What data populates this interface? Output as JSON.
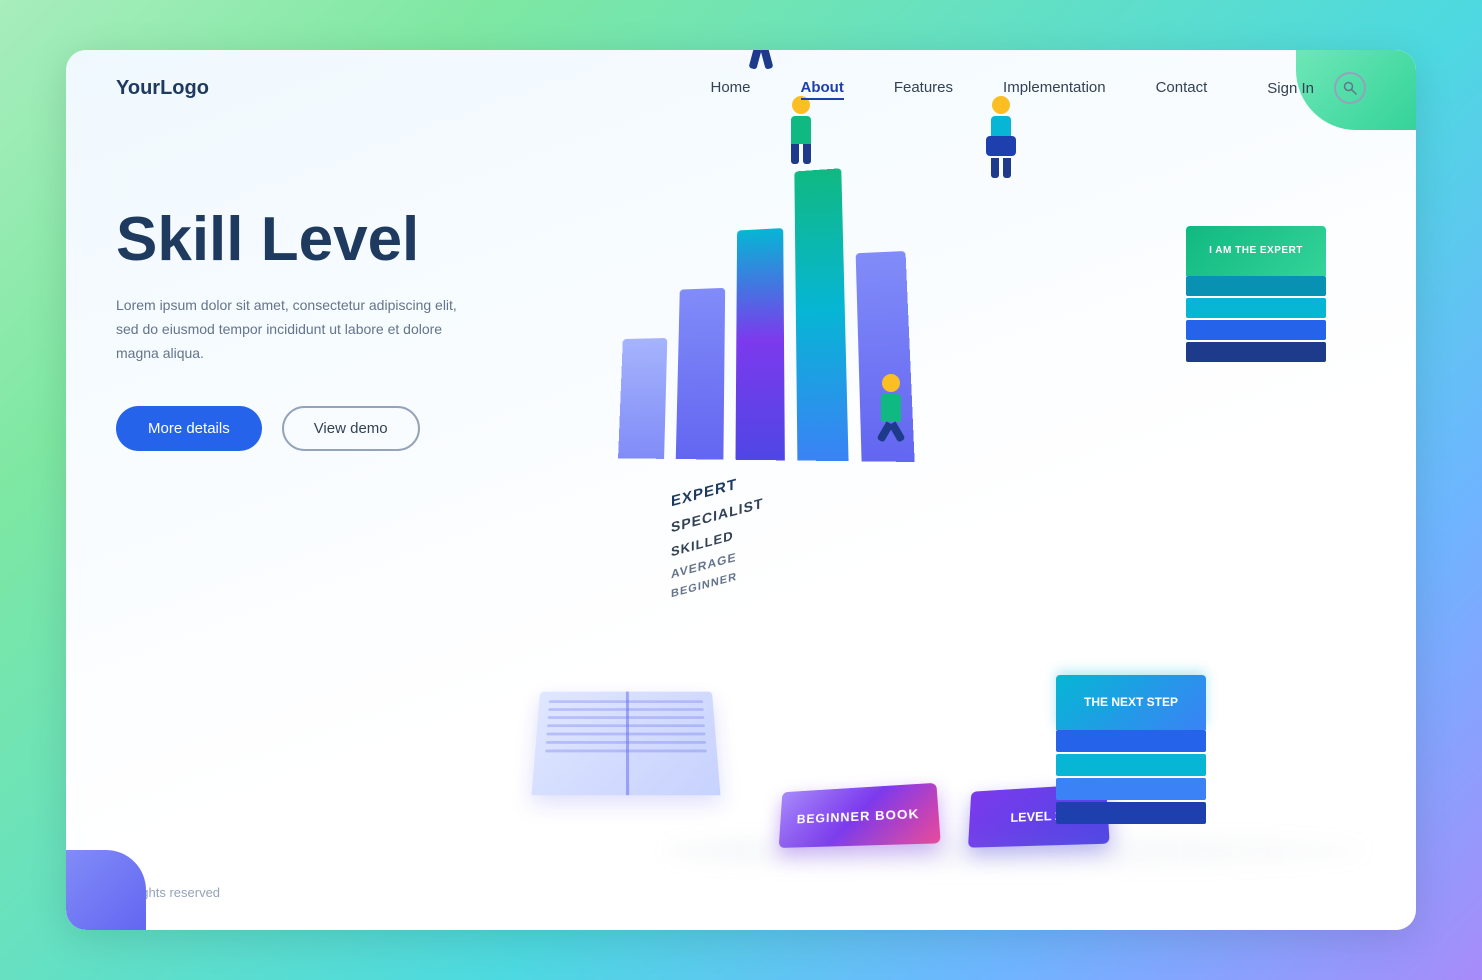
{
  "logo": "YourLogo",
  "nav": {
    "links": [
      {
        "label": "Home",
        "active": false
      },
      {
        "label": "About",
        "active": true
      },
      {
        "label": "Features",
        "active": false
      },
      {
        "label": "Implementation",
        "active": false
      },
      {
        "label": "Contact",
        "active": false
      }
    ],
    "signin": "Sign In"
  },
  "hero": {
    "title": "Skill Level",
    "description": "Lorem ipsum dolor sit amet, consectetur adipiscing elit, sed do eiusmod tempor incididunt ut labore et dolore magna aliqua.",
    "btn_primary": "More details",
    "btn_secondary": "View demo"
  },
  "skill_levels": {
    "labels": [
      "EXPERT",
      "SPECIALIST",
      "SKILLED",
      "AVERAGE",
      "BEGINNER"
    ]
  },
  "books": {
    "beginner": "BEGINNER BOOK",
    "level2": "LEVEL 2",
    "next_step": "THE NEXT STEP",
    "expert": "I AM THE EXPERT"
  },
  "footer": {
    "rights": "All rights reserved"
  }
}
